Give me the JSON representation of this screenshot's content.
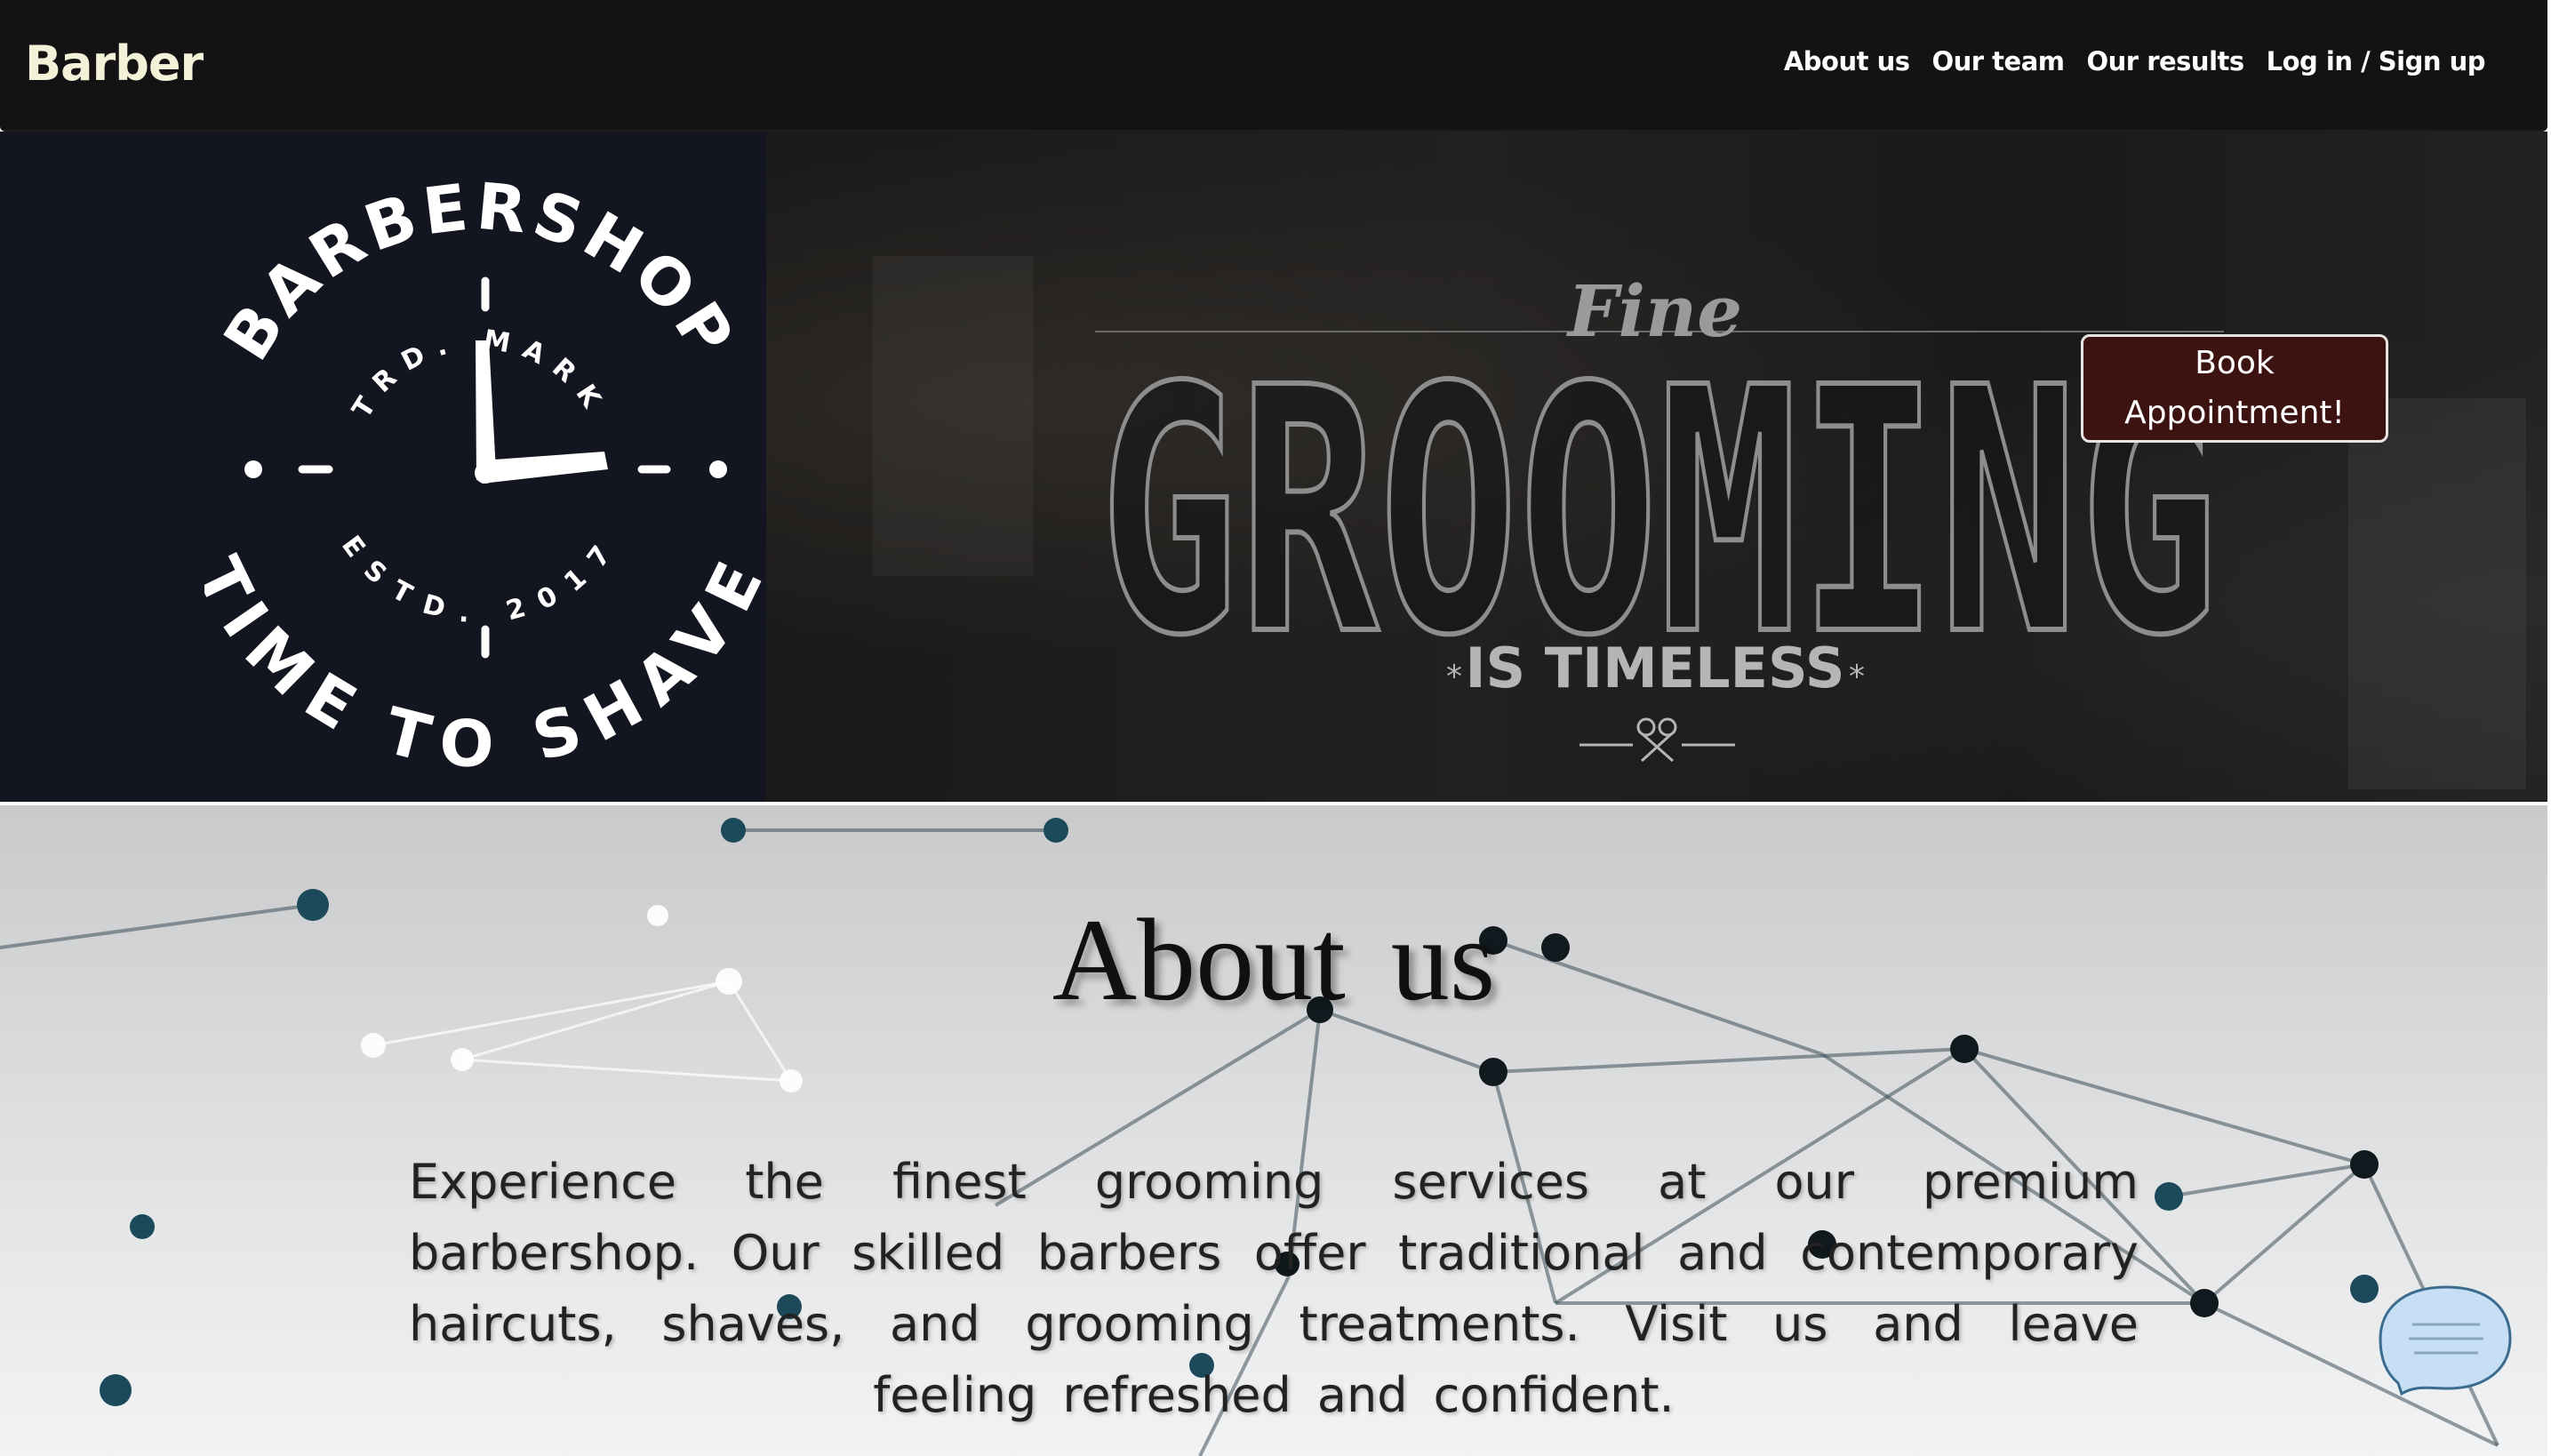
{
  "navbar": {
    "brand": "Barber",
    "links": [
      {
        "label": "About us"
      },
      {
        "label": "Our team"
      },
      {
        "label": "Our results"
      },
      {
        "label": "Log in / Sign up"
      }
    ]
  },
  "hero": {
    "logo": {
      "top_arc": "BARBERSHOP",
      "bottom_arc": "TIME TO SHAVE",
      "inner_top": "TRD. MARK",
      "inner_bottom": "ESTD. 2017"
    },
    "banner": {
      "script_word": "Fine",
      "headline": "GROOMING",
      "tagline": "IS TIMELESS"
    },
    "book_button_label": "Book Appointment!"
  },
  "about": {
    "title": "About us",
    "text": "Experience the finest grooming services at our premium barbershop. Our skilled barbers offer traditional and contemporary haircuts, shaves, and grooming treatments. Visit us and leave feeling refreshed and confident."
  },
  "chat": {
    "icon": "chat-bubble-icon",
    "color": "#c6dff4"
  },
  "colors": {
    "navbar_bg": "#141314",
    "brand": "#f3f1d8",
    "book_button_bg": "#3d1312",
    "logo_panel_bg": "#131620"
  }
}
